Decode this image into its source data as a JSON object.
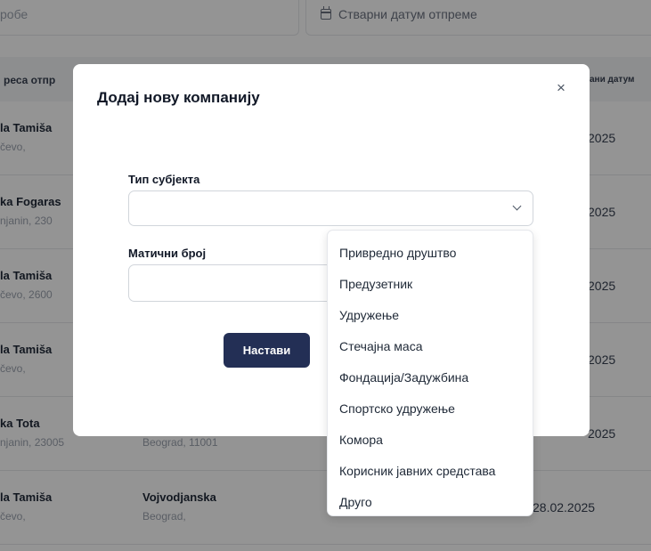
{
  "background": {
    "filter_left_text": "робе",
    "filter_right_text": "Стварни датум отпреме",
    "header_left": "реса отпр",
    "header_right": "ани датум",
    "rows": [
      {
        "name": "la Tamiša",
        "city": "čevo,",
        "name2": "",
        "city2": "",
        "date": "2025"
      },
      {
        "name": "ka Fogaras",
        "city": "njanin, 230",
        "name2": "",
        "city2": "",
        "date": "2025"
      },
      {
        "name": "la Tamiša",
        "city": "čevo, 2600",
        "name2": "",
        "city2": "",
        "date": "2025"
      },
      {
        "name": "la Tamiša",
        "city": "čevo,",
        "name2": "",
        "city2": "",
        "date": "2025"
      },
      {
        "name": "ka Tota",
        "city": "njanin, 23005",
        "name2": "",
        "city2": "Beograd, 11001",
        "date": "2025"
      },
      {
        "name": "la Tamiša",
        "city": "čevo,",
        "name2": "Vojvodjanska",
        "city2": "Beograd,",
        "date": "28.02.2025"
      }
    ]
  },
  "modal": {
    "title": "Додај нову компанију",
    "close_symbol": "×",
    "entity_type_label": "Тип субјекта",
    "entity_type_value": "",
    "registration_label": "Матични број",
    "registration_value": "",
    "registration_placeholder": "",
    "continue_label": "Настави"
  },
  "dropdown": {
    "options": [
      "Привредно друштво",
      "Предузетник",
      "Удружење",
      "Стечајна маса",
      "Фондација/Задужбина",
      "Спортско удружење",
      "Комора",
      "Корисник јавних средстава",
      "Друго"
    ]
  }
}
